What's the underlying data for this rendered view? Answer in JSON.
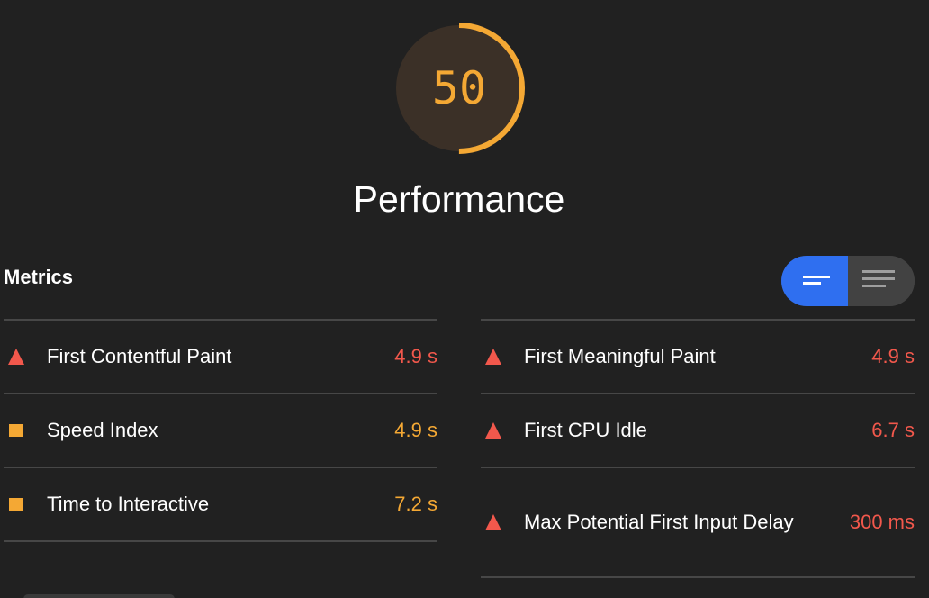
{
  "gauge": {
    "score": "50",
    "score_fraction": 0.5,
    "color": "#f4a834"
  },
  "category": {
    "title": "Performance"
  },
  "metrics": {
    "heading": "Metrics",
    "toggle": {
      "active": "compact",
      "compact_icon": "compact-view-icon",
      "expanded_icon": "expanded-view-icon",
      "active_color": "#2f6ff0"
    },
    "left_column": [
      {
        "icon": "fail-triangle-icon",
        "status": "fail",
        "title": "First Contentful Paint",
        "value": "4.9 s"
      },
      {
        "icon": "average-square-icon",
        "status": "average",
        "title": "Speed Index",
        "value": "4.9 s"
      },
      {
        "icon": "average-square-icon",
        "status": "average",
        "title": "Time to Interactive",
        "value": "7.2 s"
      }
    ],
    "right_column": [
      {
        "icon": "fail-triangle-icon",
        "status": "fail",
        "title": "First Meaningful Paint",
        "value": "4.9 s"
      },
      {
        "icon": "fail-triangle-icon",
        "status": "fail",
        "title": "First CPU Idle",
        "value": "6.7 s"
      },
      {
        "icon": "fail-triangle-icon",
        "status": "fail",
        "title": "Max Potential First Input Delay",
        "value": "300 ms"
      }
    ]
  },
  "colors": {
    "fail": "#f2584c",
    "average": "#f4a834",
    "background": "#212121"
  }
}
